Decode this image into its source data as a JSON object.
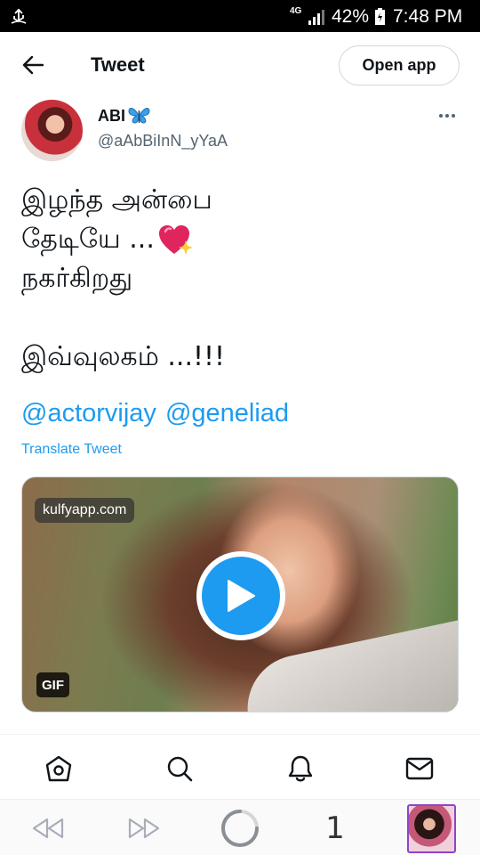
{
  "status_bar": {
    "network": "4G",
    "battery": "42%",
    "time": "7:48 PM"
  },
  "header": {
    "title": "Tweet",
    "open_app_label": "Open app"
  },
  "author": {
    "display_name": "ABI",
    "handle": "@aAbBiInN_yYaA"
  },
  "tweet": {
    "lines": [
      "இழந்த அன்பை",
      "தேடியே ...",
      "நகர்கிறது",
      "இவ்வுலகம் ...!!!"
    ],
    "mentions": [
      "@actorvijay",
      "@geneliad"
    ],
    "translate_label": "Translate Tweet"
  },
  "media": {
    "watermark": "kulfyapp.com",
    "badge": "GIF"
  },
  "bottom_nav": {
    "items": [
      "home-icon",
      "search-icon",
      "notifications-icon",
      "messages-icon"
    ]
  },
  "browser": {
    "tab_count": "1"
  },
  "colors": {
    "accent": "#1d9bf0",
    "text": "#0f1419",
    "secondary": "#536471"
  }
}
